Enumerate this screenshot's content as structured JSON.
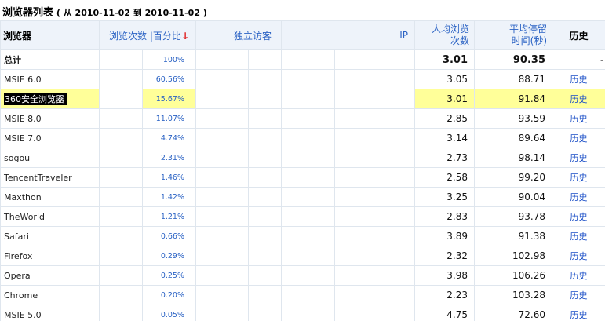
{
  "header": {
    "title": "浏览器列表",
    "range_prefix": "( 从",
    "start_date": "2010-11-02",
    "range_to": "到",
    "end_date": "2010-11-02",
    "range_suffix": ")"
  },
  "columns": {
    "browser": "浏览器",
    "visits": "浏览次数",
    "separator": "|",
    "percent": "百分比",
    "sort_arrow": "↓",
    "unique_visitors": "独立访客",
    "ip": "IP",
    "pv_per_visitor_line1": "人均浏览",
    "pv_per_visitor_line2": "次数",
    "avg_time_line1": "平均停留",
    "avg_time_line2": "时间(秒)",
    "history": "历史"
  },
  "total": {
    "name": "总计",
    "percent": "100%",
    "pv": "3.01",
    "time": "90.35",
    "history": "-"
  },
  "rows": [
    {
      "name": "MSIE 6.0",
      "percent": "60.56%",
      "pv": "3.05",
      "time": "88.71",
      "history": "历史"
    },
    {
      "name": "360安全浏览器",
      "percent": "15.67%",
      "pv": "3.01",
      "time": "91.84",
      "history": "历史",
      "highlighted": true
    },
    {
      "name": "MSIE 8.0",
      "percent": "11.07%",
      "pv": "2.85",
      "time": "93.59",
      "history": "历史"
    },
    {
      "name": "MSIE 7.0",
      "percent": "4.74%",
      "pv": "3.14",
      "time": "89.64",
      "history": "历史"
    },
    {
      "name": "sogou",
      "percent": "2.31%",
      "pv": "2.73",
      "time": "98.14",
      "history": "历史"
    },
    {
      "name": "TencentTraveler",
      "percent": "1.46%",
      "pv": "2.58",
      "time": "99.20",
      "history": "历史"
    },
    {
      "name": "Maxthon",
      "percent": "1.42%",
      "pv": "3.25",
      "time": "90.04",
      "history": "历史"
    },
    {
      "name": "TheWorld",
      "percent": "1.21%",
      "pv": "2.83",
      "time": "93.78",
      "history": "历史"
    },
    {
      "name": "Safari",
      "percent": "0.66%",
      "pv": "3.89",
      "time": "91.38",
      "history": "历史"
    },
    {
      "name": "Firefox",
      "percent": "0.29%",
      "pv": "2.32",
      "time": "102.98",
      "history": "历史"
    },
    {
      "name": "Opera",
      "percent": "0.25%",
      "pv": "3.98",
      "time": "106.26",
      "history": "历史"
    },
    {
      "name": "Chrome",
      "percent": "0.20%",
      "pv": "2.23",
      "time": "103.28",
      "history": "历史"
    },
    {
      "name": "MSIE 5.0",
      "percent": "0.05%",
      "pv": "4.75",
      "time": "72.60",
      "history": "历史"
    }
  ],
  "colors": {
    "header_bg": "#eef3fa",
    "link": "#2a62c4",
    "highlight_row": "#ffff99",
    "sort_arrow": "#e02020"
  }
}
